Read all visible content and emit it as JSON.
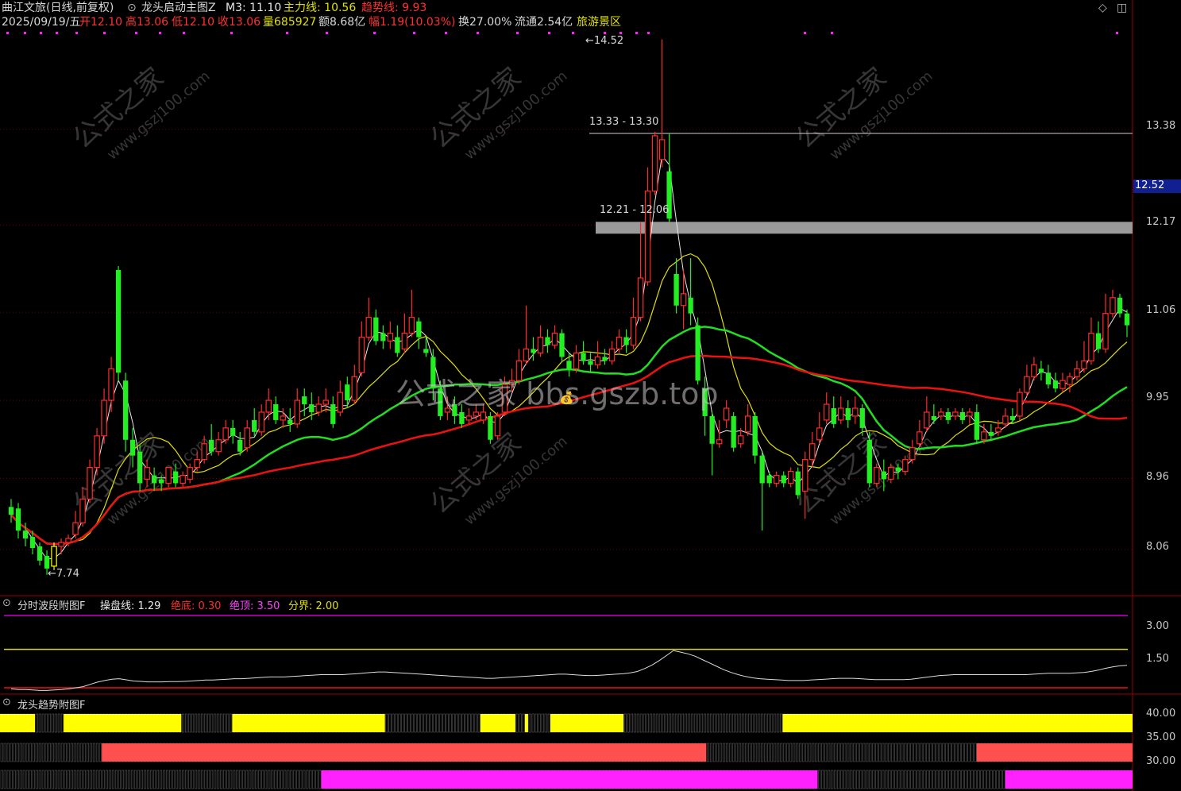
{
  "colors": {
    "up": "#ff2a2a",
    "down": "#22ee22",
    "neutral": "#ffff00",
    "ma_green": "#22dd22",
    "ma_red": "#ee1111",
    "ma_yellow": "#e0e000",
    "ma_white": "#e8e8e8",
    "grid": "#6a0000",
    "gray_band": "#9a9a9a",
    "magenta": "#ff22ff",
    "salmon": "#ff5050",
    "indicator_yellow": "#ffff00"
  },
  "header": {
    "stock": "曲江文旅(日线,前复权)",
    "formula": "龙头启动主图Z",
    "m3": "M3: 11.10",
    "zhuli": "主力线: 10.56",
    "qushi": "趋势线: 9.93",
    "corner_icons": [
      "diamond-icon",
      "window-icon"
    ]
  },
  "info": {
    "date": "2025/09/19/五",
    "open": "开12.10",
    "high": "高13.06",
    "low": "低12.10",
    "close": "收13.06",
    "volume": "量685927",
    "amount": "额8.68亿",
    "change": "幅1.19(10.03%)",
    "turnover": "换27.00%",
    "float": "流通2.54亿",
    "sector": "旅游景区"
  },
  "main_axis": {
    "ticks": [
      "13.38",
      "12.17",
      "11.06",
      "9.95",
      "8.96",
      "8.06"
    ],
    "current_price": "12.52"
  },
  "annotations": {
    "high": "14.52",
    "low": "7.74",
    "zone1": "13.33 - 13.30",
    "zone2": "12.21 - 12.06"
  },
  "watermarks": {
    "center": "公式之家 bbs.gszb.top",
    "tile": "公式之家",
    "tile_url": "www.gszj100.com"
  },
  "sub1": {
    "title": "分时波段附图F",
    "caopan": "操盘线: 1.29",
    "juedi": "绝底: 0.30",
    "jueding": "绝顶: 3.50",
    "fenjie": "分界: 2.00",
    "ticks": [
      "3.00",
      "1.50"
    ]
  },
  "sub2": {
    "title": "龙头趋势附图F",
    "ticks": [
      "40.00",
      "35.00",
      "30.00"
    ]
  },
  "chart_data": {
    "type": "candlestick",
    "title": "曲江文旅(日线,前复权)",
    "ylim": [
      7.4,
      14.9
    ],
    "candles": [
      [
        8.6,
        8.5,
        8.7,
        8.4
      ],
      [
        8.58,
        8.3,
        8.65,
        8.2
      ],
      [
        8.3,
        8.2,
        8.4,
        8.1
      ],
      [
        8.22,
        8.08,
        8.3,
        8.0
      ],
      [
        8.1,
        7.92,
        8.15,
        7.86
      ],
      [
        7.98,
        7.82,
        8.05,
        7.74
      ],
      [
        7.85,
        8.1,
        8.15,
        7.8
      ],
      [
        8.1,
        8.15,
        8.2,
        8.0
      ],
      [
        8.15,
        8.2,
        8.25,
        8.1
      ],
      [
        8.25,
        8.4,
        8.55,
        8.2
      ],
      [
        8.4,
        8.7,
        8.85,
        8.35
      ],
      [
        8.7,
        9.1,
        9.2,
        8.65
      ],
      [
        9.1,
        9.5,
        9.6,
        9.0
      ],
      [
        9.5,
        9.95,
        10.1,
        9.4
      ],
      [
        9.95,
        10.35,
        10.5,
        9.8
      ],
      [
        11.6,
        10.3,
        11.65,
        10.2
      ],
      [
        10.2,
        9.45,
        10.3,
        9.3
      ],
      [
        9.45,
        9.25,
        9.6,
        9.1
      ],
      [
        9.3,
        8.9,
        9.4,
        8.8
      ],
      [
        8.95,
        9.1,
        9.2,
        8.85
      ],
      [
        9.0,
        8.9,
        9.1,
        8.8
      ],
      [
        8.95,
        8.9,
        9.0,
        8.8
      ],
      [
        8.9,
        9.1,
        9.1,
        8.85
      ],
      [
        9.05,
        8.9,
        9.15,
        8.85
      ],
      [
        8.9,
        9.0,
        9.05,
        8.85
      ],
      [
        8.95,
        9.1,
        9.15,
        8.9
      ],
      [
        9.1,
        9.2,
        9.3,
        9.05
      ],
      [
        9.2,
        9.4,
        9.5,
        9.15
      ],
      [
        9.45,
        9.3,
        9.65,
        9.25
      ],
      [
        9.3,
        9.45,
        9.55,
        9.25
      ],
      [
        9.45,
        9.6,
        9.7,
        9.4
      ],
      [
        9.6,
        9.5,
        9.7,
        9.4
      ],
      [
        9.45,
        9.3,
        9.55,
        9.25
      ],
      [
        9.35,
        9.6,
        9.7,
        9.3
      ],
      [
        9.7,
        9.55,
        9.85,
        9.5
      ],
      [
        9.55,
        9.8,
        9.9,
        9.5
      ],
      [
        9.8,
        9.95,
        10.1,
        9.7
      ],
      [
        9.9,
        9.7,
        10.0,
        9.65
      ],
      [
        9.7,
        9.75,
        9.85,
        9.6
      ],
      [
        9.7,
        9.65,
        9.85,
        9.55
      ],
      [
        9.65,
        9.95,
        10.1,
        9.6
      ],
      [
        10.0,
        9.9,
        10.1,
        9.75
      ],
      [
        9.9,
        9.8,
        10.05,
        9.7
      ],
      [
        9.8,
        9.9,
        10.0,
        9.75
      ],
      [
        9.9,
        9.95,
        10.1,
        9.8
      ],
      [
        9.9,
        9.65,
        10.0,
        9.6
      ],
      [
        9.8,
        10.05,
        10.2,
        9.75
      ],
      [
        10.15,
        9.95,
        10.25,
        9.85
      ],
      [
        9.95,
        10.25,
        10.4,
        9.9
      ],
      [
        10.3,
        10.75,
        10.95,
        10.25
      ],
      [
        10.75,
        11.0,
        11.25,
        10.7
      ],
      [
        11.0,
        10.7,
        11.1,
        10.65
      ],
      [
        10.8,
        10.7,
        10.9,
        10.6
      ],
      [
        10.7,
        10.8,
        10.95,
        10.6
      ],
      [
        10.75,
        10.55,
        10.9,
        10.5
      ],
      [
        10.6,
        10.8,
        11.05,
        10.55
      ],
      [
        10.8,
        11.0,
        11.35,
        10.75
      ],
      [
        10.95,
        10.75,
        11.0,
        10.6
      ],
      [
        10.6,
        10.55,
        10.75,
        10.5
      ],
      [
        10.5,
        10.1,
        10.6,
        9.95
      ],
      [
        10.1,
        9.75,
        10.2,
        9.7
      ],
      [
        9.8,
        9.85,
        10.0,
        9.7
      ],
      [
        9.9,
        9.75,
        10.0,
        9.65
      ],
      [
        9.8,
        9.65,
        9.9,
        9.6
      ],
      [
        9.7,
        9.75,
        9.85,
        9.65
      ],
      [
        9.75,
        9.8,
        9.9,
        9.7
      ],
      [
        9.7,
        9.8,
        9.9,
        9.65
      ],
      [
        9.75,
        9.45,
        9.8,
        9.4
      ],
      [
        9.5,
        9.75,
        9.8,
        9.45
      ],
      [
        9.8,
        10.15,
        10.25,
        9.75
      ],
      [
        10.15,
        10.2,
        10.35,
        10.05
      ],
      [
        10.2,
        10.45,
        10.6,
        10.15
      ],
      [
        10.45,
        10.6,
        11.15,
        10.4
      ],
      [
        10.6,
        10.55,
        10.75,
        10.45
      ],
      [
        10.55,
        10.75,
        10.9,
        10.5
      ],
      [
        10.75,
        10.65,
        10.85,
        10.55
      ],
      [
        10.65,
        10.8,
        10.9,
        10.6
      ],
      [
        10.8,
        10.5,
        10.85,
        10.45
      ],
      [
        10.45,
        10.35,
        10.55,
        10.25
      ],
      [
        10.35,
        10.55,
        10.65,
        10.3
      ],
      [
        10.55,
        10.45,
        10.7,
        10.4
      ],
      [
        10.45,
        10.4,
        10.55,
        10.3
      ],
      [
        10.4,
        10.5,
        10.7,
        10.35
      ],
      [
        10.5,
        10.45,
        10.6,
        10.4
      ],
      [
        10.45,
        10.6,
        10.7,
        10.4
      ],
      [
        10.6,
        10.75,
        10.85,
        10.55
      ],
      [
        10.75,
        10.65,
        10.85,
        10.55
      ],
      [
        10.65,
        11.0,
        11.25,
        10.6
      ],
      [
        11.0,
        11.5,
        12.2,
        10.95
      ],
      [
        11.45,
        12.6,
        12.9,
        11.4
      ],
      [
        12.6,
        13.3,
        13.35,
        12.55
      ],
      [
        13.0,
        13.25,
        14.52,
        12.9
      ],
      [
        12.85,
        12.25,
        13.33,
        12.2
      ],
      [
        11.55,
        11.15,
        11.75,
        11.05
      ],
      [
        11.15,
        11.3,
        11.6,
        10.85
      ],
      [
        11.25,
        11.05,
        11.75,
        10.9
      ],
      [
        10.9,
        10.2,
        11.0,
        10.15
      ],
      [
        10.1,
        9.75,
        10.25,
        9.5
      ],
      [
        9.75,
        9.4,
        9.8,
        9.0
      ],
      [
        9.4,
        9.45,
        9.7,
        9.35
      ],
      [
        9.7,
        9.85,
        9.95,
        9.6
      ],
      [
        9.75,
        9.35,
        9.8,
        9.3
      ],
      [
        9.4,
        9.5,
        9.6,
        9.35
      ],
      [
        9.55,
        9.75,
        9.9,
        9.5
      ],
      [
        9.75,
        9.25,
        9.8,
        9.15
      ],
      [
        9.25,
        8.9,
        9.3,
        8.3
      ],
      [
        9.0,
        8.9,
        9.05,
        8.85
      ],
      [
        8.9,
        9.0,
        9.05,
        8.85
      ],
      [
        9.0,
        8.9,
        9.05,
        8.85
      ],
      [
        8.9,
        9.05,
        9.1,
        8.85
      ],
      [
        9.05,
        8.75,
        9.1,
        8.7
      ],
      [
        8.8,
        9.2,
        9.3,
        8.45
      ],
      [
        9.2,
        9.4,
        9.55,
        9.1
      ],
      [
        9.45,
        9.6,
        9.8,
        9.4
      ],
      [
        9.7,
        9.9,
        10.05,
        9.65
      ],
      [
        9.85,
        9.65,
        10.0,
        9.6
      ],
      [
        9.7,
        9.85,
        10.0,
        9.65
      ],
      [
        9.85,
        9.7,
        9.95,
        9.6
      ],
      [
        9.75,
        9.85,
        10.0,
        9.65
      ],
      [
        9.85,
        9.6,
        9.9,
        9.5
      ],
      [
        9.45,
        8.9,
        9.55,
        8.85
      ],
      [
        8.9,
        9.1,
        9.15,
        8.85
      ],
      [
        9.05,
        8.95,
        9.2,
        8.8
      ],
      [
        8.95,
        9.1,
        9.15,
        8.9
      ],
      [
        9.1,
        9.05,
        9.15,
        8.95
      ],
      [
        9.05,
        9.2,
        9.25,
        9.0
      ],
      [
        9.2,
        9.35,
        9.45,
        9.15
      ],
      [
        9.4,
        9.55,
        9.7,
        9.35
      ],
      [
        9.6,
        9.8,
        10.0,
        9.55
      ],
      [
        9.75,
        9.7,
        9.9,
        9.65
      ],
      [
        9.75,
        9.8,
        9.85,
        9.7
      ],
      [
        9.8,
        9.7,
        9.85,
        9.65
      ],
      [
        9.75,
        9.8,
        9.85,
        9.7
      ],
      [
        9.8,
        9.7,
        9.85,
        9.65
      ],
      [
        9.75,
        9.8,
        9.85,
        9.65
      ],
      [
        9.8,
        9.45,
        9.9,
        9.4
      ],
      [
        9.45,
        9.55,
        9.65,
        9.4
      ],
      [
        9.55,
        9.5,
        9.65,
        9.45
      ],
      [
        9.55,
        9.6,
        9.7,
        9.5
      ],
      [
        9.65,
        9.75,
        9.85,
        9.6
      ],
      [
        9.75,
        9.7,
        9.85,
        9.65
      ],
      [
        9.75,
        10.05,
        10.1,
        9.7
      ],
      [
        10.05,
        10.25,
        10.4,
        10.0
      ],
      [
        10.25,
        10.4,
        10.5,
        10.2
      ],
      [
        10.35,
        10.3,
        10.45,
        10.2
      ],
      [
        10.3,
        10.15,
        10.4,
        10.1
      ],
      [
        10.2,
        10.1,
        10.3,
        10.05
      ],
      [
        10.1,
        10.2,
        10.3,
        10.05
      ],
      [
        10.15,
        10.25,
        10.3,
        10.05
      ],
      [
        10.25,
        10.35,
        10.45,
        10.2
      ],
      [
        10.35,
        10.45,
        10.7,
        10.3
      ],
      [
        10.45,
        10.8,
        11.0,
        10.4
      ],
      [
        10.8,
        10.6,
        10.95,
        10.55
      ],
      [
        10.6,
        11.05,
        11.3,
        10.55
      ],
      [
        11.05,
        11.25,
        11.35,
        11.0
      ],
      [
        11.25,
        11.05,
        11.3,
        11.0
      ],
      [
        11.05,
        10.9,
        11.1,
        10.75
      ]
    ],
    "ma_lines": [
      {
        "name": "白线",
        "color": "#e8e8e8"
      },
      {
        "name": "黄线",
        "color": "#e0e000"
      },
      {
        "name": "绿线",
        "color": "#22dd22"
      },
      {
        "name": "红线",
        "color": "#ee1111"
      }
    ],
    "sub1_ylim": [
      0,
      3.8
    ],
    "sub1_levels": [
      {
        "value": 3.5,
        "color": "#cc00cc"
      },
      {
        "value": 2.0,
        "color": "#dddd00"
      },
      {
        "value": 0.3,
        "color": "#ee1111"
      }
    ],
    "sub1_line": [
      0.25,
      0.22,
      0.22,
      0.2,
      0.18,
      0.18,
      0.2,
      0.22,
      0.25,
      0.3,
      0.35,
      0.45,
      0.55,
      0.62,
      0.68,
      0.7,
      0.65,
      0.6,
      0.58,
      0.56,
      0.56,
      0.56,
      0.57,
      0.57,
      0.58,
      0.6,
      0.62,
      0.64,
      0.64,
      0.66,
      0.68,
      0.7,
      0.7,
      0.72,
      0.74,
      0.76,
      0.78,
      0.78,
      0.78,
      0.8,
      0.82,
      0.84,
      0.86,
      0.88,
      0.88,
      0.88,
      0.88,
      0.9,
      0.92,
      0.95,
      0.98,
      1.0,
      1.0,
      0.98,
      0.96,
      0.94,
      0.92,
      0.9,
      0.88,
      0.86,
      0.84,
      0.82,
      0.8,
      0.78,
      0.76,
      0.74,
      0.72,
      0.72,
      0.74,
      0.76,
      0.78,
      0.8,
      0.82,
      0.84,
      0.86,
      0.88,
      0.9,
      0.9,
      0.88,
      0.86,
      0.84,
      0.84,
      0.86,
      0.88,
      0.9,
      0.92,
      0.96,
      1.02,
      1.15,
      1.3,
      1.5,
      1.72,
      1.95,
      1.88,
      1.8,
      1.7,
      1.55,
      1.4,
      1.25,
      1.1,
      0.98,
      0.88,
      0.8,
      0.74,
      0.7,
      0.68,
      0.66,
      0.64,
      0.62,
      0.62,
      0.62,
      0.64,
      0.66,
      0.68,
      0.7,
      0.72,
      0.72,
      0.72,
      0.7,
      0.68,
      0.66,
      0.66,
      0.66,
      0.66,
      0.66,
      0.68,
      0.72,
      0.76,
      0.8,
      0.84,
      0.86,
      0.88,
      0.88,
      0.88,
      0.88,
      0.88,
      0.88,
      0.88,
      0.88,
      0.88,
      0.88,
      0.88,
      0.9,
      0.92,
      0.94,
      0.94,
      0.94,
      0.94,
      0.96,
      0.98,
      1.02,
      1.08,
      1.16,
      1.22,
      1.27,
      1.29
    ],
    "sub2_bands": [
      {
        "row": 0,
        "color": "#ffff00",
        "segments": [
          [
            0,
            11
          ],
          [
            20,
            57
          ],
          [
            73,
            121
          ],
          [
            151,
            162
          ],
          [
            165,
            166
          ],
          [
            173,
            196
          ],
          [
            246,
            356
          ]
        ]
      },
      {
        "row": 1,
        "color": "#ff5050",
        "segments": [
          [
            32,
            222
          ],
          [
            307,
            356
          ]
        ]
      },
      {
        "row": 2,
        "color": "#ff22ff",
        "segments": [
          [
            101,
            257
          ],
          [
            316,
            356
          ]
        ]
      }
    ]
  }
}
